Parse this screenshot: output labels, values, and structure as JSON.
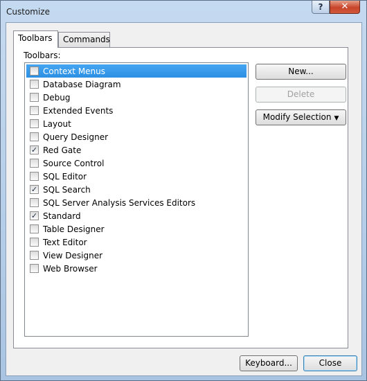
{
  "window": {
    "title": "Customize",
    "help_label": "?",
    "close_label": "✕"
  },
  "tabs": [
    {
      "label": "Toolbars",
      "active": true
    },
    {
      "label": "Commands",
      "active": false
    }
  ],
  "panel": {
    "list_label": "Toolbars:",
    "items": [
      {
        "label": "Context Menus",
        "checked": false,
        "selected": true
      },
      {
        "label": "Database Diagram",
        "checked": false
      },
      {
        "label": "Debug",
        "checked": false
      },
      {
        "label": "Extended Events",
        "checked": false
      },
      {
        "label": "Layout",
        "checked": false
      },
      {
        "label": "Query Designer",
        "checked": false
      },
      {
        "label": "Red Gate",
        "checked": true
      },
      {
        "label": "Source Control",
        "checked": false
      },
      {
        "label": "SQL Editor",
        "checked": false
      },
      {
        "label": "SQL Search",
        "checked": true
      },
      {
        "label": "SQL Server Analysis Services Editors",
        "checked": false
      },
      {
        "label": "Standard",
        "checked": true
      },
      {
        "label": "Table Designer",
        "checked": false
      },
      {
        "label": "Text Editor",
        "checked": false
      },
      {
        "label": "View Designer",
        "checked": false
      },
      {
        "label": "Web Browser",
        "checked": false
      }
    ],
    "buttons": {
      "new": "New...",
      "delete": "Delete",
      "modify": "Modify Selection"
    }
  },
  "footer": {
    "keyboard": "Keyboard...",
    "close": "Close"
  },
  "colors": {
    "selection": "#3399ff",
    "close_button": "#c7442a"
  }
}
